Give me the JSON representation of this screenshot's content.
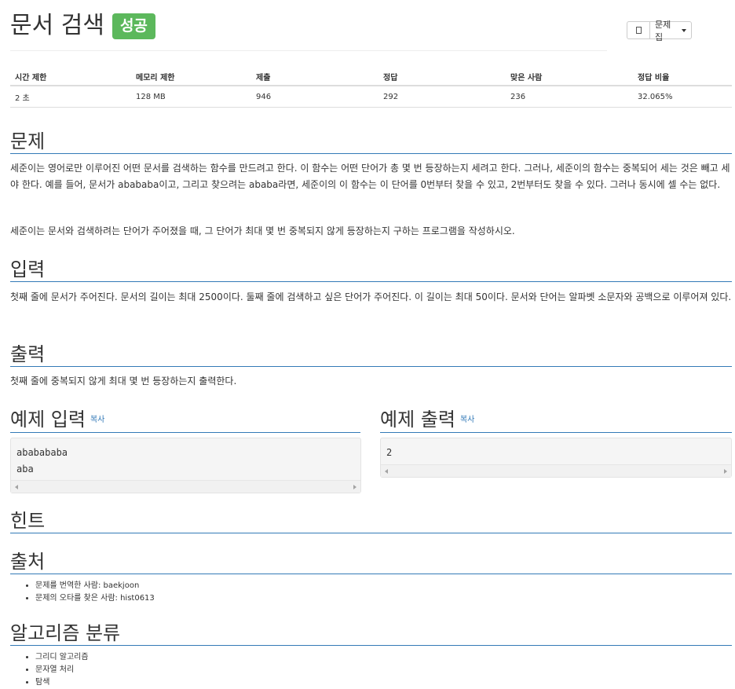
{
  "header": {
    "title": "문서 검색",
    "badge": "성공",
    "problemset_label": "문제집"
  },
  "info_table": {
    "headers": [
      "시간 제한",
      "메모리 제한",
      "제출",
      "정답",
      "맞은 사람",
      "정답 비율"
    ],
    "values": [
      "2 초",
      "128 MB",
      "946",
      "292",
      "236",
      "32.065%"
    ]
  },
  "problem": {
    "heading": "문제",
    "para1": "세준이는 영어로만 이루어진 어떤 문서를 검색하는 함수를 만드려고 한다. 이 함수는 어떤 단어가 총 몇 번 등장하는지 세려고 한다. 그러나, 세준이의 함수는 중복되어 세는 것은 빼고 세야 한다. 예를 들어, 문서가 abababa이고, 그리고 찾으려는 ababa라면, 세준이의 이 함수는 이 단어를 0번부터 찾을 수 있고, 2번부터도 찾을 수 있다. 그러나 동시에 셀 수는 없다.",
    "para2": "세준이는 문서와 검색하려는 단어가 주어졌을 때, 그 단어가 최대 몇 번 중복되지 않게 등장하는지 구하는 프로그램을 작성하시오."
  },
  "input": {
    "heading": "입력",
    "text": "첫째 줄에 문서가 주어진다. 문서의 길이는 최대 2500이다. 둘째 줄에 검색하고 싶은 단어가 주어진다. 이 길이는 최대 50이다. 문서와 단어는 알파벳 소문자와 공백으로 이루어져 있다."
  },
  "output": {
    "heading": "출력",
    "text": "첫째 줄에 중복되지 않게 최대 몇 번 등장하는지 출력한다."
  },
  "sample_input": {
    "heading": "예제 입력",
    "copy": "복사",
    "content": "ababababa\naba"
  },
  "sample_output": {
    "heading": "예제 출력",
    "copy": "복사",
    "content": "2"
  },
  "hint": {
    "heading": "힌트"
  },
  "source": {
    "heading": "출처",
    "items": [
      "문제를 번역한 사람: baekjoon",
      "문제의 오타를 찾은 사람: hist0613"
    ]
  },
  "algorithm": {
    "heading": "알고리즘 분류",
    "items": [
      "그리디 알고리즘",
      "문자열 처리",
      "탐색"
    ]
  },
  "colors": {
    "badge": "#5cb85c",
    "link": "#337ab7"
  }
}
